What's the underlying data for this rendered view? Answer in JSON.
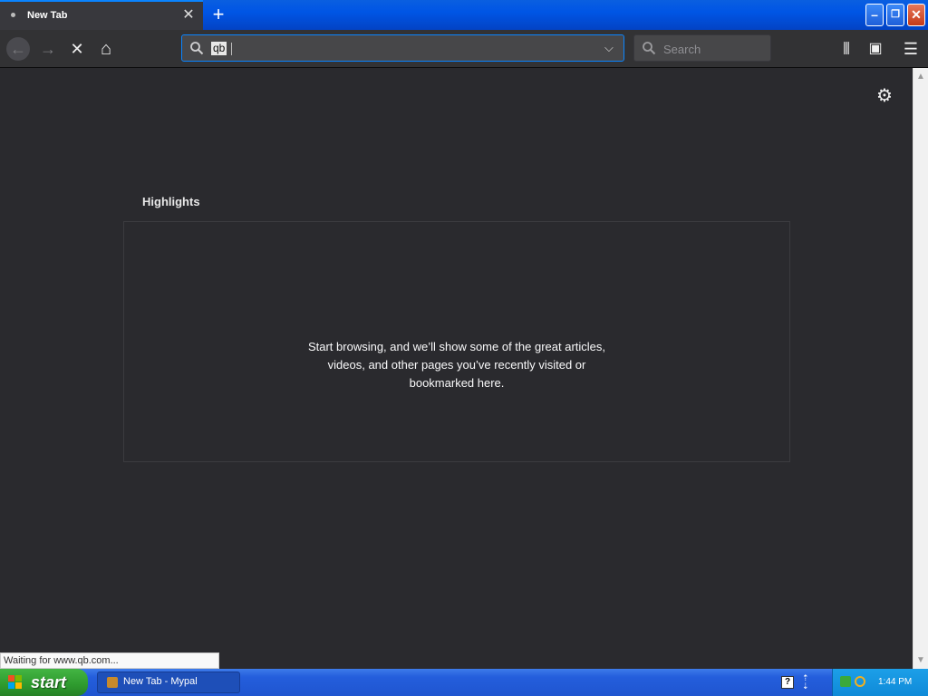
{
  "tab": {
    "title": "New Tab",
    "close_glyph": "✕"
  },
  "new_tab_glyph": "+",
  "window_controls": {
    "minimize": "–",
    "restore": "❐",
    "close": "✕"
  },
  "navbar": {
    "back_glyph": "←",
    "forward_glyph": "→",
    "stop_glyph": "✕",
    "home_glyph": "⌂",
    "url_value": "qb",
    "dropdown_glyph": "⌵",
    "search_placeholder": "Search",
    "library_glyph": "⫴",
    "sidebar_glyph": "▣",
    "menu_glyph": "☰"
  },
  "content": {
    "settings_glyph": "⚙",
    "highlights_title": "Highlights",
    "highlights_message_line1": "Start browsing, and we’ll show some of the great articles,",
    "highlights_message_line2": "videos, and other pages you’ve recently visited or",
    "highlights_message_line3": "bookmarked here."
  },
  "status_text": "Waiting for www.qb.com...",
  "taskbar": {
    "start_label": "start",
    "task_label": "New Tab - Mypal",
    "help_glyph": "?",
    "clock": "1:44 PM"
  },
  "icons": [
    "back-arrow-icon",
    "forward-arrow-icon",
    "stop-icon",
    "home-icon",
    "search-icon",
    "dropdown-chevron-icon",
    "library-icon",
    "sidebar-icon",
    "hamburger-menu-icon",
    "gear-icon",
    "windows-flag-icon"
  ],
  "colors": {
    "accent": "#0a84ff",
    "content_bg": "#2a2a2e",
    "toolbar_bg": "#323234",
    "xp_blue": "#0055e5",
    "xp_green": "#2e9a2e"
  }
}
